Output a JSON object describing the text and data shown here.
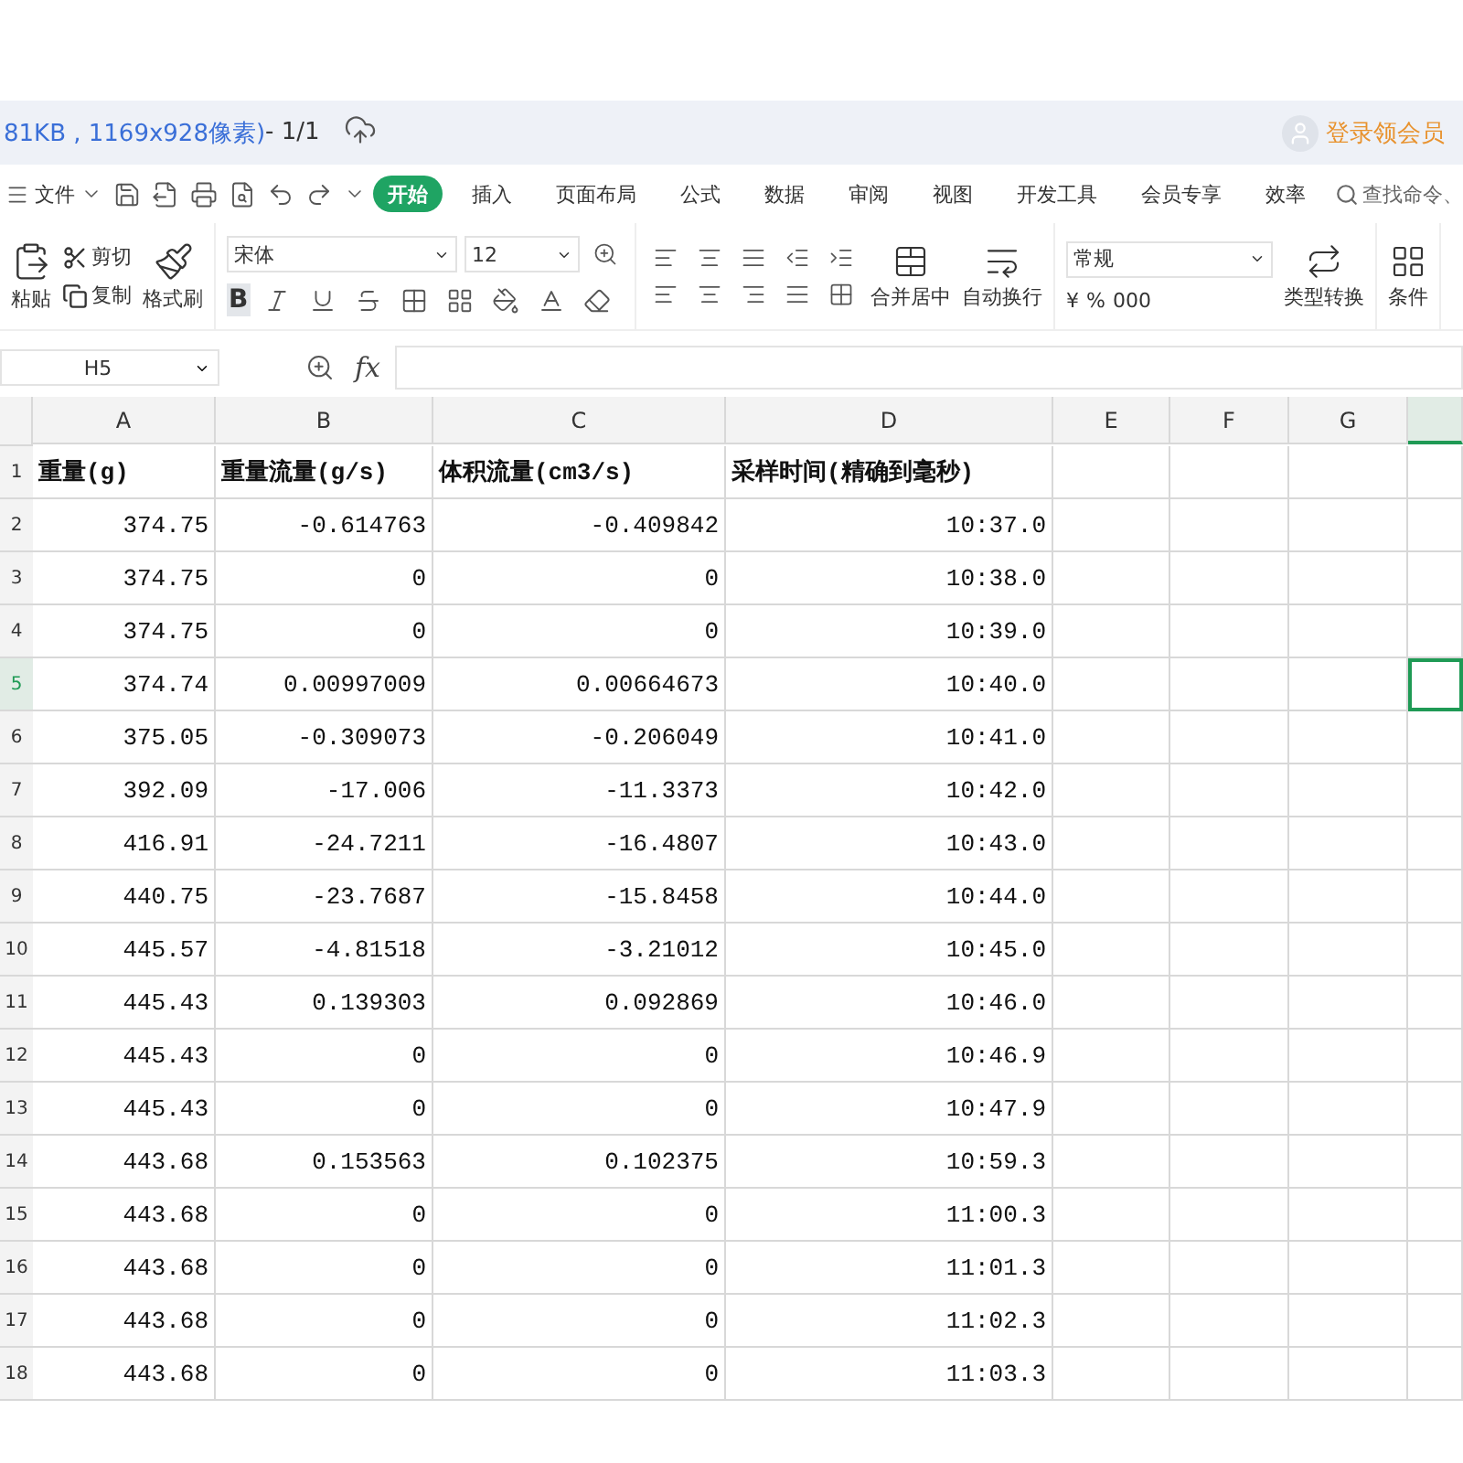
{
  "title_bar": {
    "file_info": "81KB , 1169x928像素)",
    "page": " - 1/1",
    "user": "登录领会员"
  },
  "menu": {
    "file": "文件",
    "tabs": [
      {
        "label": "开始",
        "selected": true
      },
      {
        "label": "插入",
        "selected": false
      },
      {
        "label": "页面布局",
        "selected": false
      },
      {
        "label": "公式",
        "selected": false
      },
      {
        "label": "数据",
        "selected": false
      },
      {
        "label": "审阅",
        "selected": false
      },
      {
        "label": "视图",
        "selected": false
      },
      {
        "label": "开发工具",
        "selected": false
      },
      {
        "label": "会员专享",
        "selected": false
      },
      {
        "label": "效率",
        "selected": false
      }
    ],
    "search": {
      "placeholder": "查找命令、"
    }
  },
  "ribbon": {
    "paste": "粘贴",
    "cut": "剪切",
    "copy": "复制",
    "format_painter": "格式刷",
    "font_name": "宋体",
    "font_size": "12",
    "bold_label": "B",
    "bold_active": true,
    "merge": "合并居中",
    "wrap": "自动换行",
    "number_format": "常规",
    "currency": "¥",
    "percent": "%",
    "thousands": "000",
    "convert": "类型转换",
    "conditional": "条件"
  },
  "formula_bar": {
    "cell_ref": "H5",
    "fx": "fx"
  },
  "sheet": {
    "columns": [
      {
        "label": "A",
        "selected": false
      },
      {
        "label": "B",
        "selected": false
      },
      {
        "label": "C",
        "selected": false
      },
      {
        "label": "D",
        "selected": false
      },
      {
        "label": "E",
        "selected": false
      },
      {
        "label": "F",
        "selected": false
      },
      {
        "label": "G",
        "selected": false
      },
      {
        "selected": true
      }
    ],
    "row_numbers": [
      {
        "label": "1",
        "selected": false
      },
      {
        "label": "2",
        "selected": false
      },
      {
        "label": "3",
        "selected": false
      },
      {
        "label": "4",
        "selected": false
      },
      {
        "label": "5",
        "selected": true
      },
      {
        "label": "6",
        "selected": false
      },
      {
        "label": "7",
        "selected": false
      },
      {
        "label": "8",
        "selected": false
      },
      {
        "label": "9",
        "selected": false
      },
      {
        "label": "10",
        "selected": false
      },
      {
        "label": "11",
        "selected": false
      },
      {
        "label": "12",
        "selected": false
      },
      {
        "label": "13",
        "selected": false
      },
      {
        "label": "14",
        "selected": false
      },
      {
        "label": "15",
        "selected": false
      },
      {
        "label": "16",
        "selected": false
      },
      {
        "label": "17",
        "selected": false
      },
      {
        "label": "18",
        "selected": false
      }
    ],
    "header_row": [
      "重量(g)",
      "重量流量(g/s)",
      "体积流量(cm3/s)",
      "采样时间(精确到毫秒)"
    ],
    "rows": [
      [
        "374.75",
        "-0.614763",
        "-0.409842",
        "10:37.0"
      ],
      [
        "374.75",
        "0",
        "0",
        "10:38.0"
      ],
      [
        "374.75",
        "0",
        "0",
        "10:39.0"
      ],
      [
        "374.74",
        "0.00997009",
        "0.00664673",
        "10:40.0"
      ],
      [
        "375.05",
        "-0.309073",
        "-0.206049",
        "10:41.0"
      ],
      [
        "392.09",
        "-17.006",
        "-11.3373",
        "10:42.0"
      ],
      [
        "416.91",
        "-24.7211",
        "-16.4807",
        "10:43.0"
      ],
      [
        "440.75",
        "-23.7687",
        "-15.8458",
        "10:44.0"
      ],
      [
        "445.57",
        "-4.81518",
        "-3.21012",
        "10:45.0"
      ],
      [
        "445.43",
        "0.139303",
        "0.092869",
        "10:46.0"
      ],
      [
        "445.43",
        "0",
        "0",
        "10:46.9"
      ],
      [
        "445.43",
        "0",
        "0",
        "10:47.9"
      ],
      [
        "443.68",
        "0.153563",
        "0.102375",
        "10:59.3"
      ],
      [
        "443.68",
        "0",
        "0",
        "11:00.3"
      ],
      [
        "443.68",
        "0",
        "0",
        "11:01.3"
      ],
      [
        "443.68",
        "0",
        "0",
        "11:02.3"
      ],
      [
        "443.68",
        "0",
        "0",
        "11:03.3"
      ]
    ]
  }
}
